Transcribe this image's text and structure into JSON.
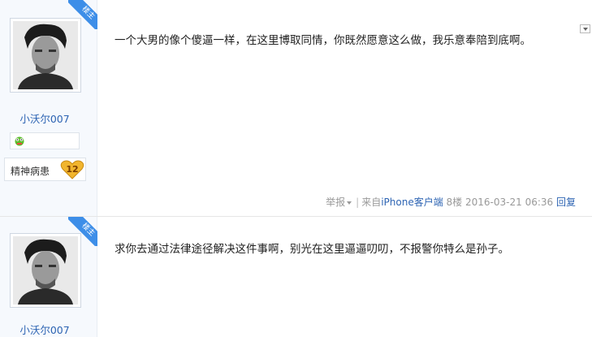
{
  "posts": [
    {
      "username": "小沃尔007",
      "badge": "楼主",
      "tag": "精神病患",
      "level": "12",
      "content": "一个大男的像个傻逼一样，在这里博取同情，你既然愿意这么做，我乐意奉陪到底啊。",
      "meta": {
        "report": "举报",
        "source_prefix": "来自",
        "client": "iPhone客户端",
        "floor": "8楼",
        "time": "2016-03-21 06:36",
        "reply": "回复"
      }
    },
    {
      "username": "小沃尔007",
      "badge": "楼主",
      "content": "求你去通过法律途径解决这件事啊，别光在这里逼逼叨叨，不报警你特么是孙子。"
    }
  ],
  "icons": {
    "level_icon": "green-frog-icon",
    "badge_icon": "gold-heart-level-icon",
    "menu_icon": "dropdown-arrow-icon"
  },
  "colors": {
    "link": "#2d64b3",
    "ribbon": "#3d8ee8",
    "side_bg": "#f6f9fd"
  }
}
